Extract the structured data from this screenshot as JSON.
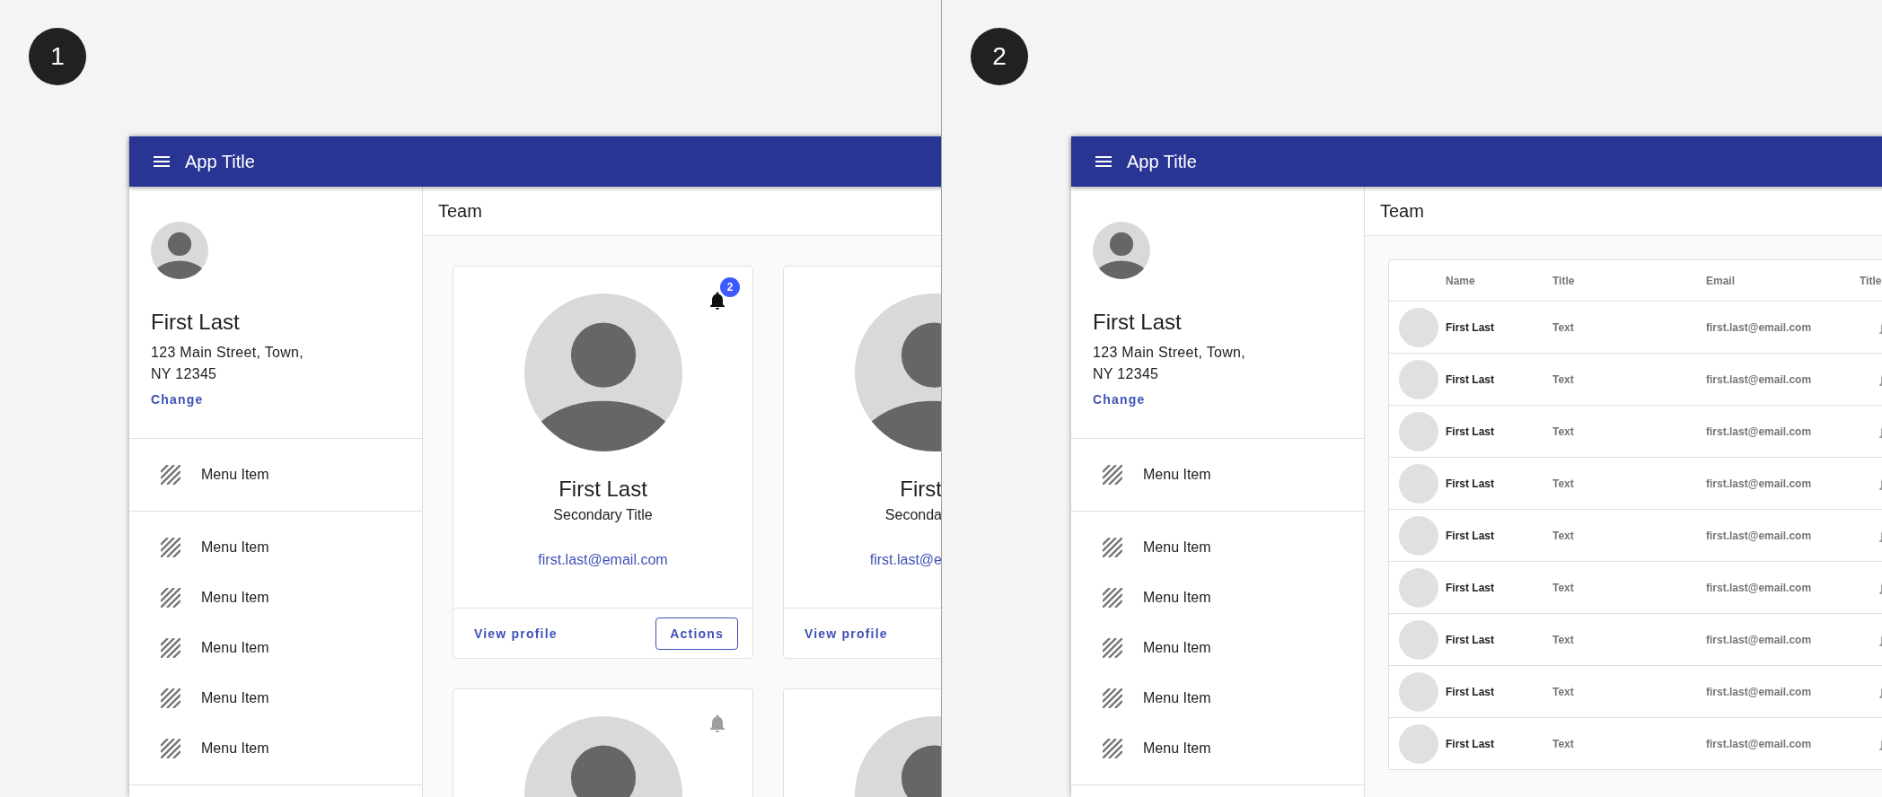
{
  "panels": [
    {
      "number": "1",
      "app": {
        "title": "App Title",
        "profile": {
          "name": "First Last",
          "address": [
            "123 Main Street, Town,",
            "NY 12345"
          ],
          "link": "Change"
        },
        "menu_groups": [
          [
            "Menu Item"
          ],
          [
            "Menu Item",
            "Menu Item",
            "Menu Item",
            "Menu Item",
            "Menu Item"
          ]
        ],
        "page_title": "Team",
        "content": {
          "kind": "cards",
          "cards": [
            {
              "kind": "profile",
              "name": "First Last",
              "secondary": "Secondary Title",
              "email": "first.last@email.com",
              "link": "View profile",
              "action": "Actions",
              "bell": {
                "active": true,
                "count": "2"
              }
            },
            {
              "kind": "profile",
              "cut_off": true,
              "name": "First",
              "secondary": "Seconda",
              "email": "first.last@e",
              "link": "View profile"
            },
            {
              "kind": "profile",
              "bell": {
                "active": false
              }
            },
            {
              "kind": "profile"
            }
          ]
        }
      }
    },
    {
      "number": "2",
      "app": {
        "title": "App Title",
        "profile": {
          "name": "First Last",
          "address": [
            "123 Main Street, Town,",
            "NY 12345"
          ],
          "link": "Change"
        },
        "menu_groups": [
          [
            "Menu Item"
          ],
          [
            "Menu Item",
            "Menu Item",
            "Menu Item",
            "Menu Item",
            "Menu Item"
          ]
        ],
        "page_title": "Team",
        "content": {
          "kind": "table",
          "columns": [
            "Name",
            "Title",
            "Email",
            "Title"
          ],
          "rows": [
            {
              "name": "First Last",
              "title": "Text",
              "email": "first.last@email.com"
            },
            {
              "name": "First Last",
              "title": "Text",
              "email": "first.last@email.com"
            },
            {
              "name": "First Last",
              "title": "Text",
              "email": "first.last@email.com"
            },
            {
              "name": "First Last",
              "title": "Text",
              "email": "first.last@email.com"
            },
            {
              "name": "First Last",
              "title": "Text",
              "email": "first.last@email.com"
            },
            {
              "name": "First Last",
              "title": "Text",
              "email": "first.last@email.com"
            },
            {
              "name": "First Last",
              "title": "Text",
              "email": "first.last@email.com"
            },
            {
              "name": "First Last",
              "title": "Text",
              "email": "first.last@email.com"
            },
            {
              "name": "First Last",
              "title": "Text",
              "email": "first.last@email.com"
            }
          ]
        }
      }
    }
  ]
}
